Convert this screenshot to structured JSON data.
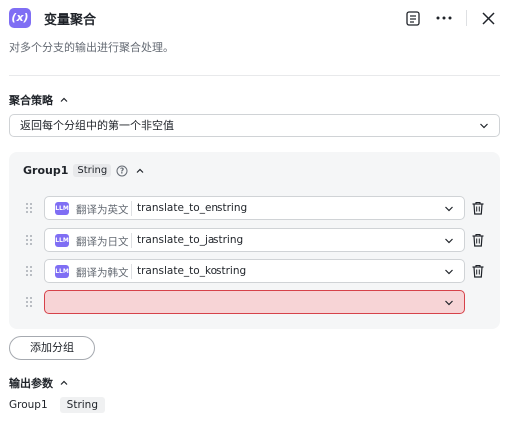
{
  "header": {
    "icon_text": "(x)",
    "title": "变量聚合"
  },
  "description": "对多个分支的输出进行聚合处理。",
  "strategy": {
    "label": "聚合策略",
    "selected": "返回每个分组中的第一个非空值"
  },
  "group": {
    "name": "Group1",
    "type": "String",
    "variables": [
      {
        "icon": "LLM",
        "node": "翻译为英文",
        "name": "translate_to_en",
        "type": "string"
      },
      {
        "icon": "LLM",
        "node": "翻译为日文",
        "name": "translate_to_ja",
        "type": "string"
      },
      {
        "icon": "LLM",
        "node": "翻译为韩文",
        "name": "translate_to_ko",
        "type": "string"
      }
    ]
  },
  "add_group_label": "添加分组",
  "output": {
    "label": "输出参数",
    "name": "Group1",
    "type": "String"
  },
  "colors": {
    "accent": "#7f6ef4",
    "error_bg": "#f7d4d6",
    "error_border": "#d6424a"
  },
  "icons": [
    "variable-aggregator-icon",
    "notes-icon",
    "more-icon",
    "close-icon",
    "chevron-up-icon",
    "chevron-down-icon",
    "help-icon",
    "drag-handle-icon",
    "llm-node-icon",
    "trash-icon"
  ]
}
